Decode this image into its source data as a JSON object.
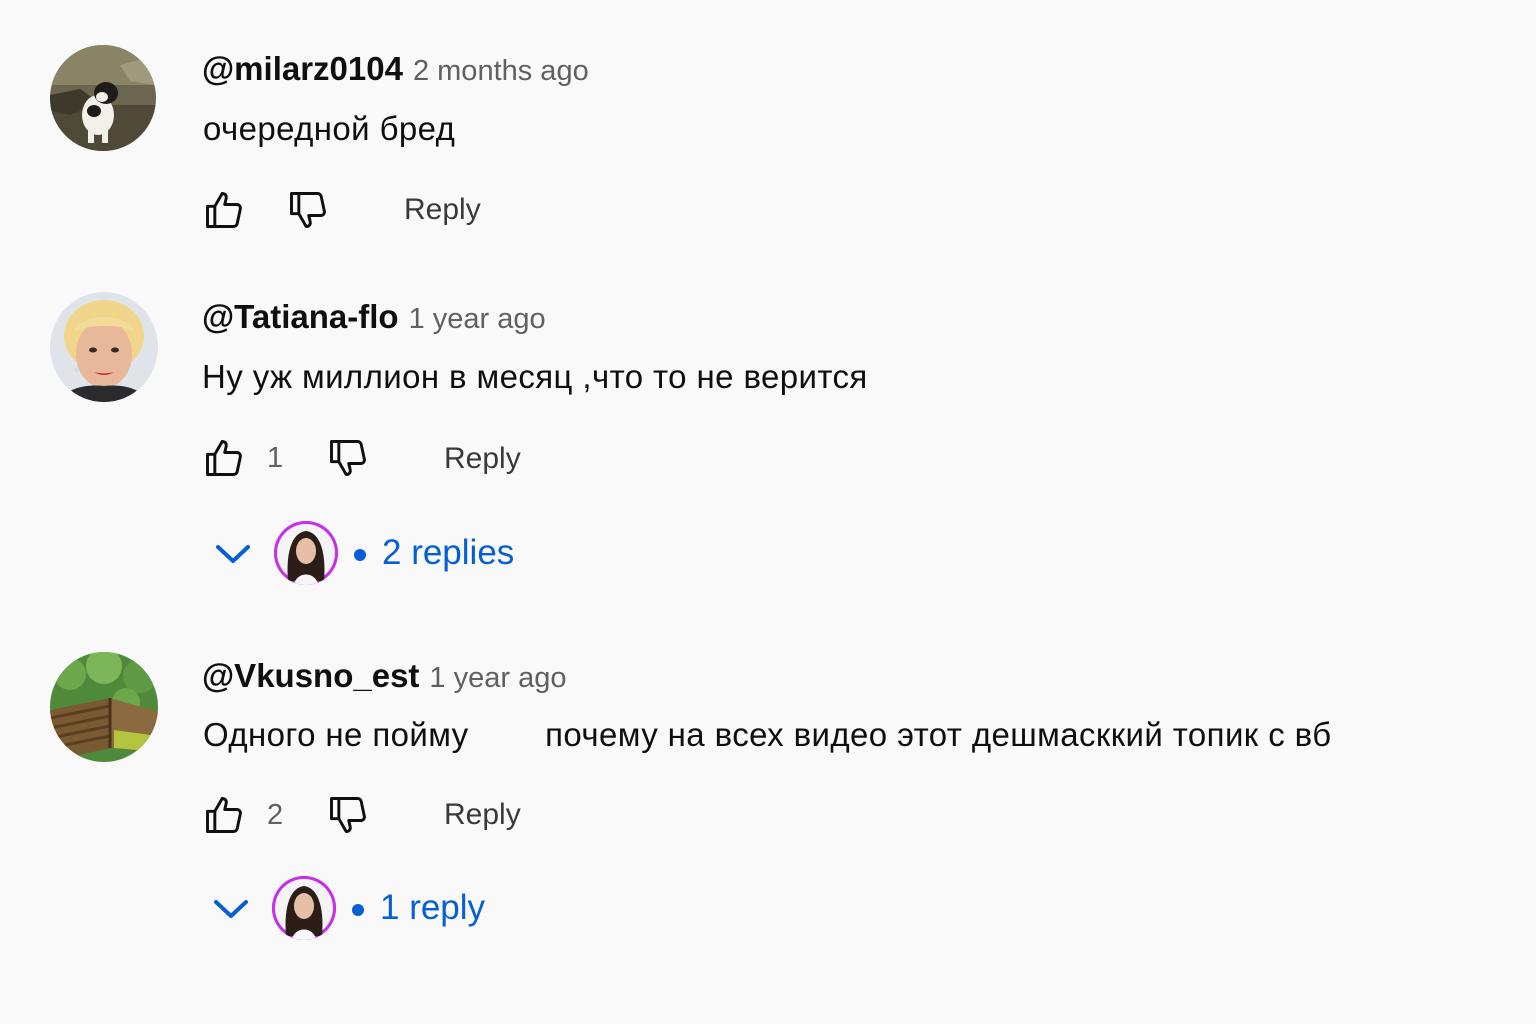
{
  "comments": [
    {
      "handle": "@milarz0104",
      "time": "2 months ago",
      "text": "очередной бред",
      "likes": "",
      "reply_label": "Reply",
      "avatar_icon": "dog-photo-avatar"
    },
    {
      "handle": "@Tatiana-flo",
      "time": "1 year ago",
      "text": "Ну уж миллион в месяц ,что то не верится",
      "likes": "1",
      "reply_label": "Reply",
      "avatar_icon": "woman-photo-avatar",
      "replies_label": "2 replies"
    },
    {
      "handle": "@Vkusno_est",
      "time": "1 year ago",
      "text": "Одного не пойму        почему на всех видео этот дешмасккий топик с вб",
      "likes": "2",
      "reply_label": "Reply",
      "avatar_icon": "garden-bed-photo-avatar",
      "replies_label": "1 reply"
    }
  ],
  "colors": {
    "background": "#f9f9f9",
    "primary_text": "#0f0f0f",
    "secondary_text": "#606060",
    "link_blue": "#065fd4",
    "creator_avatar_bg": "#c631e8"
  }
}
